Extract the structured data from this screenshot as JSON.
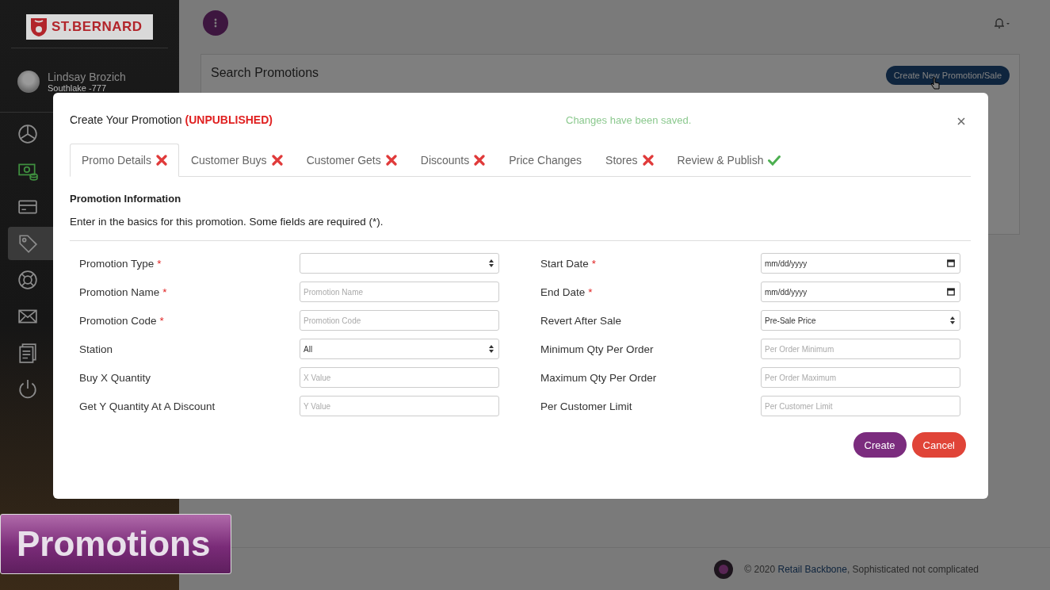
{
  "sidebar": {
    "logo": "ST.BERNARD",
    "user": {
      "name": "Lindsay Brozich",
      "store": "Southlake -777"
    },
    "nav_items": [
      {
        "kind": "chart",
        "selected": false,
        "color": "#8c8c8c"
      },
      {
        "kind": "money",
        "selected": false,
        "color": "#3f8f3f"
      },
      {
        "kind": "card",
        "selected": false,
        "color": "#8c8c8c"
      },
      {
        "kind": "tag",
        "selected": true,
        "color": "#8c8c8c"
      },
      {
        "kind": "lifebuoy",
        "selected": false,
        "color": "#8c8c8c"
      },
      {
        "kind": "mail",
        "selected": false,
        "color": "#8c8c8c"
      },
      {
        "kind": "document",
        "selected": false,
        "color": "#8c8c8c"
      },
      {
        "kind": "power",
        "selected": false,
        "color": "#8c8c8c"
      }
    ]
  },
  "page": {
    "title": "Search Promotions",
    "create_button": "Create New Promotion/Sale"
  },
  "footer": {
    "text_before": "© 2020",
    "link": "Retail Backbone",
    "text_after": ", Sophisticated not complicated"
  },
  "caption": "Promotions",
  "modal": {
    "title": "Create Your Promotion",
    "status": "(UNPUBLISHED)",
    "notice": "Changes have been saved.",
    "tabs": [
      {
        "label": "Promo Details",
        "selected": true,
        "valid": false
      },
      {
        "label": "Customer Buys",
        "selected": false,
        "valid": false
      },
      {
        "label": "Customer Gets",
        "selected": false,
        "valid": false
      },
      {
        "label": "Discounts",
        "selected": false,
        "valid": false
      },
      {
        "label": "Price Changes",
        "selected": false
      },
      {
        "label": "Stores",
        "selected": false,
        "valid": false
      },
      {
        "label": "Review & Publish",
        "selected": false,
        "valid": true
      }
    ],
    "section_title": "Promotion Information",
    "section_text": "Enter in the basics for this promotion. Some fields are required (*).",
    "left_fields": [
      {
        "label": "Promotion Type",
        "required_mark": "*",
        "kind": "select"
      },
      {
        "label": "Promotion Name",
        "required_mark": "*",
        "kind": "input",
        "placeholder": "Promotion Name"
      },
      {
        "label": "Promotion Code",
        "required_mark": "*",
        "kind": "input",
        "placeholder": "Promotion Code"
      },
      {
        "label": "Station",
        "kind": "select",
        "value": "All"
      },
      {
        "label": "Buy X Quantity",
        "kind": "input",
        "placeholder": "X Value"
      },
      {
        "label": "Get Y Quantity At A Discount",
        "kind": "input",
        "placeholder": "Y Value"
      }
    ],
    "right_fields": [
      {
        "label": "Start Date",
        "required_mark": "*",
        "kind": "date",
        "value": "mm/dd/yyyy"
      },
      {
        "label": "End Date",
        "required_mark": "*",
        "kind": "date",
        "value": "mm/dd/yyyy"
      },
      {
        "label": "Revert After Sale",
        "kind": "select",
        "value": "Pre-Sale Price"
      },
      {
        "label": "Minimum Qty Per Order",
        "kind": "input",
        "placeholder": "Per Order Minimum"
      },
      {
        "label": "Maximum Qty Per Order",
        "kind": "input",
        "placeholder": "Per Order Maximum"
      },
      {
        "label": "Per Customer Limit",
        "kind": "input",
        "placeholder": "Per Customer Limit"
      }
    ],
    "buttons": [
      {
        "label": "Create",
        "kind": "primary"
      },
      {
        "label": "Cancel",
        "kind": "danger"
      }
    ]
  }
}
